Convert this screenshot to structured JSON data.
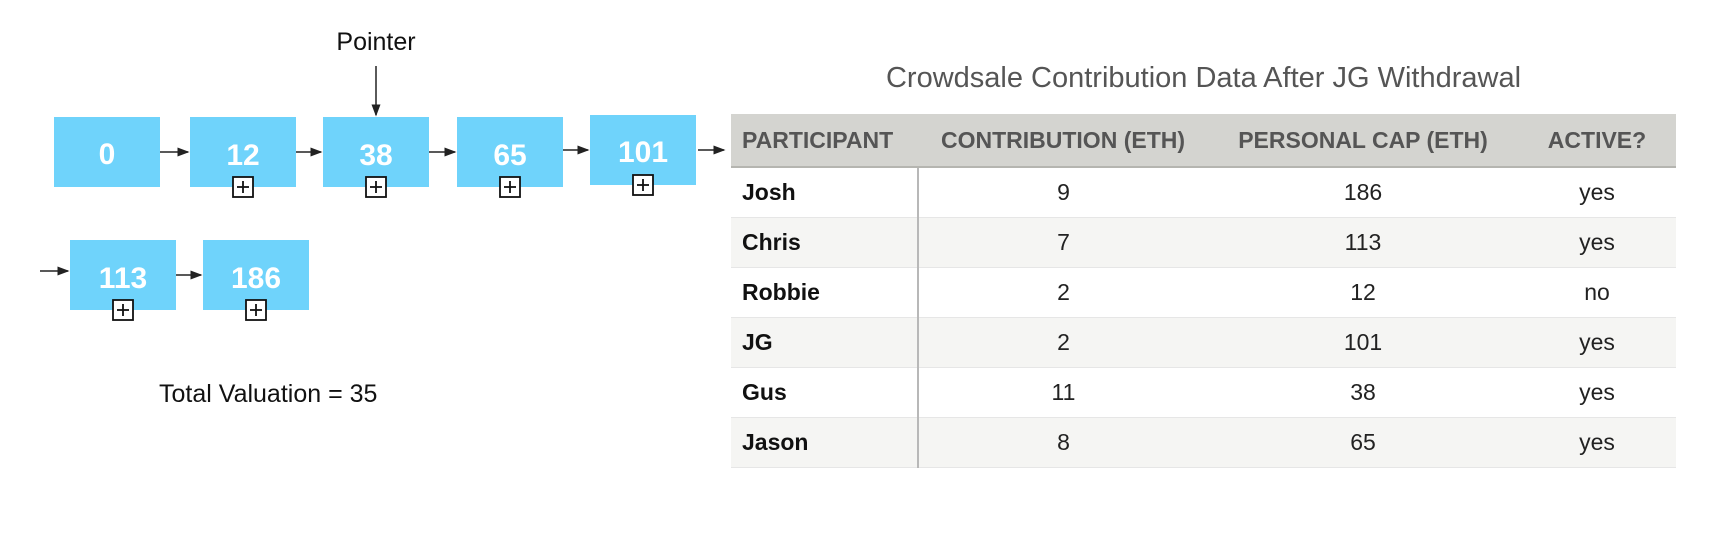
{
  "diagram": {
    "pointer_label": "Pointer",
    "nodes": [
      "0",
      "12",
      "38",
      "65",
      "101",
      "113",
      "186"
    ],
    "expand_icon": "plus-box-icon",
    "total_label": "Total Valuation = 35",
    "node_color": "#6fd3fb"
  },
  "table": {
    "title": "Crowdsale Contribution Data After JG Withdrawal",
    "headers": [
      "PARTICIPANT",
      "CONTRIBUTION (ETH)",
      "PERSONAL CAP (ETH)",
      "ACTIVE?"
    ],
    "rows": [
      [
        "Josh",
        "9",
        "186",
        "yes"
      ],
      [
        "Chris",
        "7",
        "113",
        "yes"
      ],
      [
        "Robbie",
        "2",
        "12",
        "no"
      ],
      [
        "JG",
        "2",
        "101",
        "yes"
      ],
      [
        "Gus",
        "11",
        "38",
        "yes"
      ],
      [
        "Jason",
        "8",
        "65",
        "yes"
      ]
    ]
  }
}
